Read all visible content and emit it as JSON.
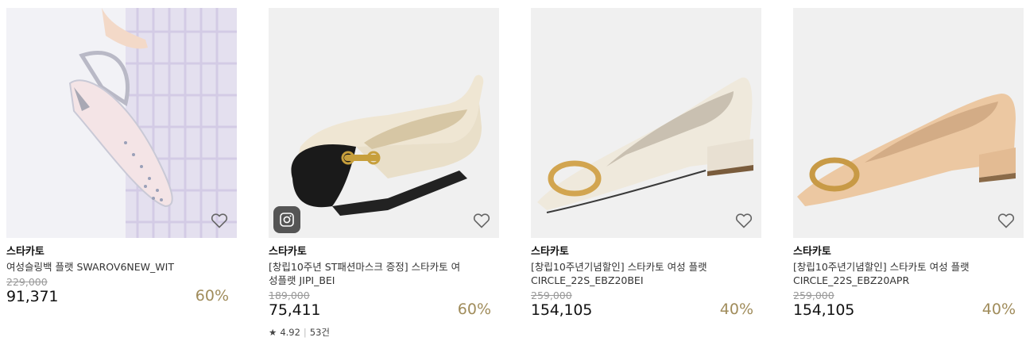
{
  "products": [
    {
      "brand": "스타카토",
      "name": "여성슬링백 플랫 SWAROV6NEW_WIT",
      "original_price": "229,000",
      "sale_price": "91,371",
      "discount": "60%"
    },
    {
      "brand": "스타카토",
      "name": "[창립10주년 ST패션마스크 증정] 스타카토 여성플랫 JIPI_BEI",
      "original_price": "189,000",
      "sale_price": "75,411",
      "discount": "60%",
      "rating": "4.92",
      "review_count": "53건"
    },
    {
      "brand": "스타카토",
      "name": "[창립10주년기념할인] 스타카토 여성 플랫 CIRCLE_22S_EBZ20BEI",
      "original_price": "259,000",
      "sale_price": "154,105",
      "discount": "40%"
    },
    {
      "brand": "스타카토",
      "name": "[창립10주년기념할인] 스타카토 여성 플랫 CIRCLE_22S_EBZ20APR",
      "original_price": "259,000",
      "sale_price": "154,105",
      "discount": "40%"
    }
  ],
  "colors": {
    "discount": "#a08c5b",
    "original_price": "#999999",
    "image_bg": "#efefef"
  },
  "icons": {
    "wishlist": "heart-outline-icon",
    "instagram": "instagram-icon",
    "rating": "star-icon"
  }
}
